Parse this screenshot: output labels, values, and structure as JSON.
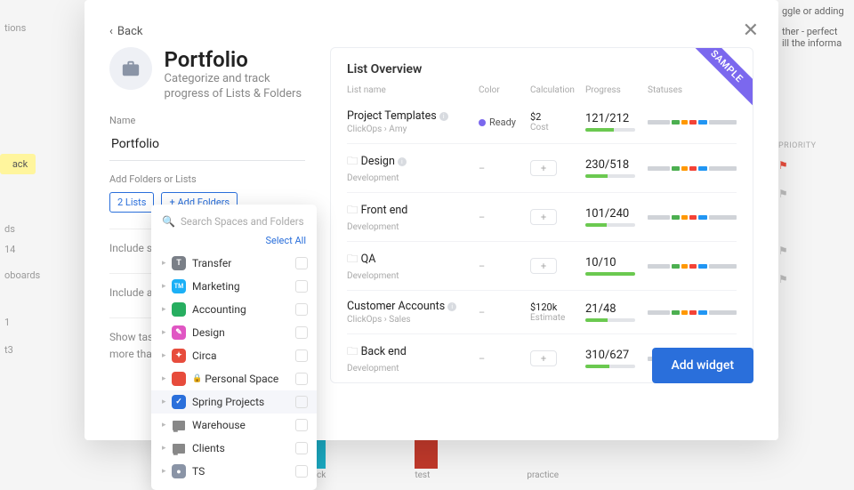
{
  "back_label": "Back",
  "title": "Portfolio",
  "subtitle": "Categorize and track progress of Lists & Folders",
  "name_label": "Name",
  "name_value": "Portfolio",
  "add_label": "Add Folders or Lists",
  "chip_lists": "2 Lists",
  "chip_add_folders": "+ Add Folders",
  "faded_rows": [
    "Include su",
    "Include are",
    "Show task\nmore than"
  ],
  "preview_title": "List Overview",
  "cols": {
    "name": "List name",
    "color": "Color",
    "calc": "Calculation",
    "prog": "Progress",
    "stat": "Statuses"
  },
  "rows": [
    {
      "title": "Project Templates",
      "info": true,
      "bc": "ClickOps  ›  Amy",
      "color_label": "Ready",
      "calc_val": "$2",
      "calc_lab": "Cost",
      "prog": "121/212",
      "fill": 57
    },
    {
      "title": "Design",
      "folder": true,
      "info": true,
      "bc": "Development",
      "prog": "230/518",
      "fill": 44
    },
    {
      "title": "Front end",
      "folder": true,
      "bc": "Development",
      "prog": "101/240",
      "fill": 42
    },
    {
      "title": "QA",
      "folder": true,
      "bc": "Development",
      "prog": "10/10",
      "fill": 100
    },
    {
      "title": "Customer Accounts",
      "info": true,
      "bc": "ClickOps  ›  Sales",
      "calc_val": "$120k",
      "calc_lab": "Estimate",
      "prog": "21/48",
      "fill": 44
    },
    {
      "title": "Back end",
      "folder": true,
      "bc": "Development",
      "prog": "310/627",
      "fill": 49
    }
  ],
  "sample_label": "SAMPLE",
  "add_widget_label": "Add widget",
  "dropdown": {
    "search_placeholder": "Search Spaces and Folders",
    "select_all": "Select All",
    "items": [
      {
        "label": "Transfer",
        "color": "#7a7f87",
        "letter": "T"
      },
      {
        "label": "Marketing",
        "color": "#1cb0f6",
        "letter": "TM",
        "fs": "7px"
      },
      {
        "label": "Accounting",
        "color": "#27ae60",
        "letter": ""
      },
      {
        "label": "Design",
        "color": "#e056c3",
        "letter": "✎"
      },
      {
        "label": "Circa",
        "color": "#e74c3c",
        "letter": "✦"
      },
      {
        "label": "Personal Space",
        "color": "#e74c3c",
        "letter": "",
        "lock": true
      },
      {
        "label": "Spring Projects",
        "color": "#2a6fdb",
        "letter": "✓",
        "hov": true
      },
      {
        "label": "Warehouse",
        "folder": true
      },
      {
        "label": "Clients",
        "folder": true
      },
      {
        "label": "TS",
        "color": "#8a94a6",
        "letter": "●"
      }
    ]
  },
  "bg_right_header": "PRIORITY",
  "bg_bottom": [
    "check",
    "test",
    "practice"
  ]
}
